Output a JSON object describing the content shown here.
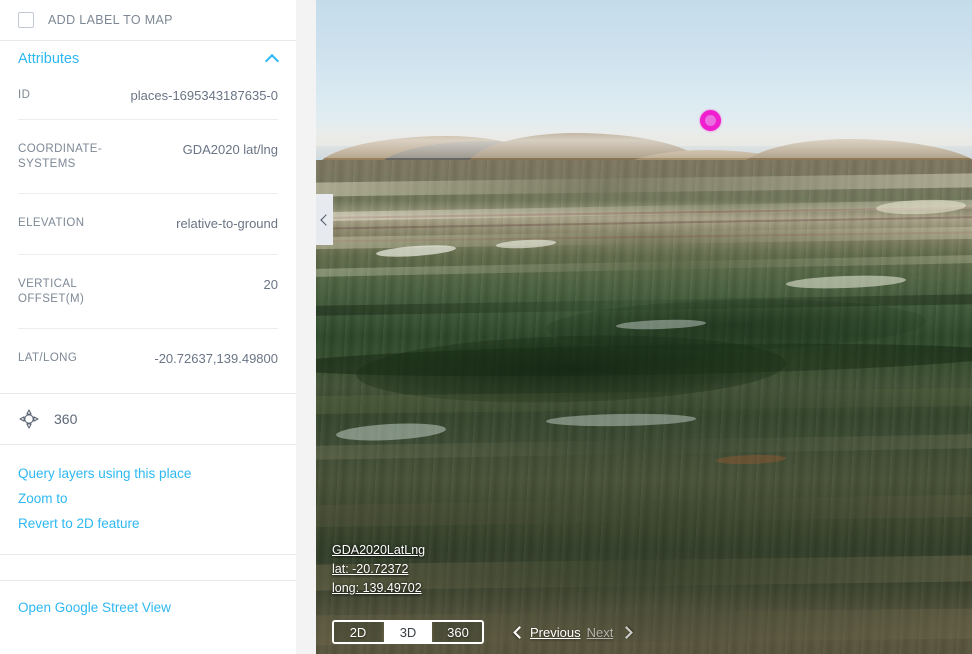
{
  "panel": {
    "add_label": {
      "label": "ADD LABEL TO MAP",
      "checked": false
    },
    "attributes_section": {
      "title": "Attributes",
      "expanded": true,
      "chevron_icon": "chevron-up-icon",
      "rows": [
        {
          "label": "ID",
          "value": "places-1695343187635-0"
        },
        {
          "label": "COORDINATE-SYSTEMS",
          "value": "GDA2020 lat/lng"
        },
        {
          "label": "ELEVATION",
          "value": "relative-to-ground"
        },
        {
          "label": "VERTICAL OFFSET(M)",
          "value": "20"
        },
        {
          "label": "LAT/LONG",
          "value": "-20.72637,139.49800"
        }
      ]
    },
    "pano_row": {
      "icon": "pano-360-icon",
      "label": "360"
    },
    "actions": [
      {
        "label": "Query layers using this place"
      },
      {
        "label": "Zoom to"
      },
      {
        "label": "Revert to 2D feature"
      }
    ],
    "street_view": {
      "label": "Open Google Street View"
    }
  },
  "map": {
    "collapse_tab_icon": "chevron-left-icon",
    "marker": {
      "name": "place-marker",
      "ring_color": "#ef1fd0",
      "fill_color": "#eb6fe0"
    },
    "coordinate_overlay": {
      "datum": "GDA2020LatLng",
      "lat": "lat: -20.72372",
      "long": "long: 139.49702"
    },
    "view_toggle": {
      "options": [
        "2D",
        "3D",
        "360"
      ],
      "selected": "3D"
    },
    "pager": {
      "previous_label": "Previous",
      "next_label": "Next",
      "previous_enabled": true,
      "next_enabled": false,
      "prev_icon": "chevron-left-icon",
      "next_icon": "chevron-right-icon"
    }
  },
  "colors": {
    "link_blue": "#2eb8f2",
    "label_gray": "#7d8895",
    "value_gray": "#6a7585",
    "marker_magenta": "#ef1fd0",
    "divider": "#e8e9ec"
  }
}
